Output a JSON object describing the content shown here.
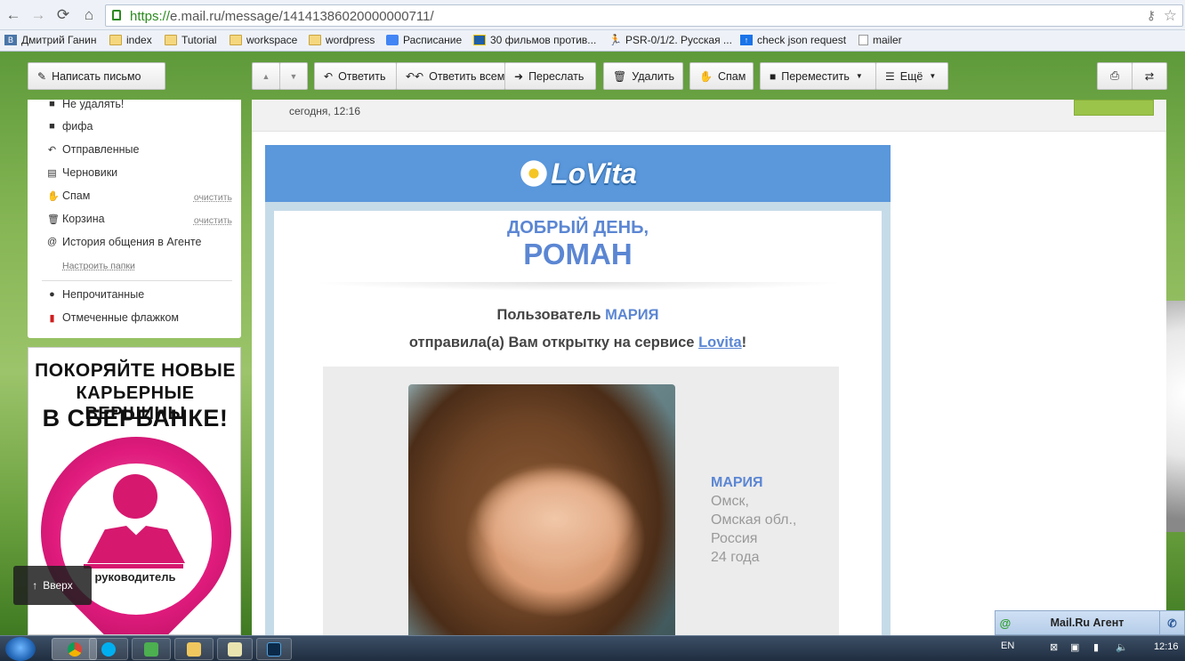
{
  "browser": {
    "url_scheme": "https://",
    "url_rest": "e.mail.ru/message/14141386020000000711/",
    "bookmarks": [
      "Дмитрий Ганин",
      "index",
      "Tutorial",
      "workspace",
      "wordpress",
      "Расписание",
      "30 фильмов против...",
      "PSR-0/1/2. Русская ...",
      "check json request",
      "mailer"
    ]
  },
  "toolbar": {
    "compose": "Написать письмо",
    "reply": "Ответить",
    "reply_all": "Ответить всем",
    "forward": "Переслать",
    "delete": "Удалить",
    "spam": "Спам",
    "move": "Переместить",
    "more": "Ещё"
  },
  "sidebar": {
    "folders": [
      "Не удалять!",
      "фифа",
      "Отправленные",
      "Черновики",
      "Спам",
      "Корзина",
      "История общения в Агенте"
    ],
    "clean_label": "очистить",
    "setup_folders": "Настроить папки",
    "unread": "Непрочитанные",
    "flagged": "Отмеченные флажком"
  },
  "ad": {
    "line1": "ПОКОРЯЙТЕ НОВЫЕ",
    "line2": "КАРЬЕРНЫЕ ВЕРШИНЫ",
    "line3": "В СБЕРБАНКЕ!",
    "role": "руководитель"
  },
  "up_button": "Вверх",
  "message": {
    "date": "сегодня, 12:16",
    "brand": "LoVita",
    "greeting1": "ДОБРЫЙ ДЕНЬ,",
    "greeting2": "РОМАН",
    "sent_prefix": "Пользователь",
    "sent_name": "МАРИЯ",
    "sent_line2_prefix": "отправила(а) Вам открытку на сервисе",
    "sent_link": "Lovita",
    "sent_suffix": "!",
    "profile": {
      "name": "МАРИЯ",
      "city": "Омск,",
      "region": "Омская обл.,",
      "country": "Россия",
      "age": "24 года"
    }
  },
  "agent": {
    "label": "Mail.Ru Агент"
  },
  "taskbar": {
    "lang": "EN",
    "time": "12:16"
  },
  "colors": {
    "accent_blue": "#5b86d3",
    "lovita_header": "#5a97db",
    "sber_pink": "#e01b7d"
  }
}
